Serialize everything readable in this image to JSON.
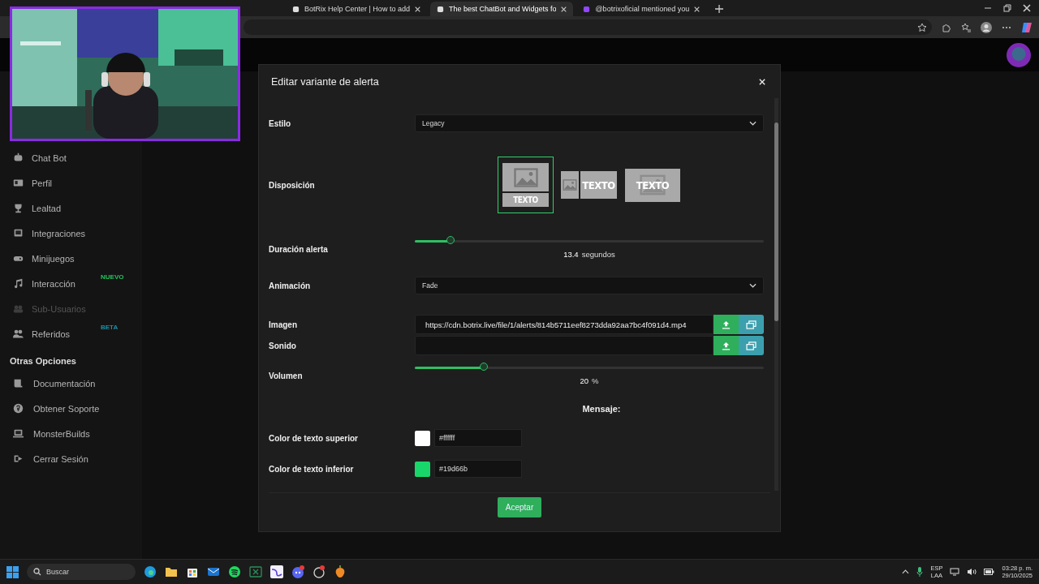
{
  "browser": {
    "tabs": [
      {
        "title": "BotRix Help Center | How to add",
        "selected": false
      },
      {
        "title": "The best ChatBot and Widgets fo",
        "selected": true
      },
      {
        "title": "@botrixoficial mentioned you",
        "selected": false
      }
    ]
  },
  "sidebar": {
    "items": [
      {
        "label": "Chat Bot",
        "disabled": false
      },
      {
        "label": "Perfil",
        "disabled": false
      },
      {
        "label": "Lealtad",
        "disabled": false
      },
      {
        "label": "Integraciones",
        "disabled": false
      },
      {
        "label": "Minijuegos",
        "disabled": false
      },
      {
        "label": "Interacción",
        "disabled": false,
        "badge": {
          "text": "NUEVO",
          "color": "#22c55e"
        }
      },
      {
        "label": "Sub-Usuarios",
        "disabled": true
      },
      {
        "label": "Referidos",
        "disabled": false,
        "badge": {
          "text": "BETA",
          "color": "#1c8fa6"
        }
      }
    ],
    "section_title": "Otras Opciones",
    "other_items": [
      {
        "label": "Documentación",
        "disabled": false
      },
      {
        "label": "Obtener Soporte",
        "disabled": false
      },
      {
        "label": "MonsterBuilds",
        "disabled": false
      },
      {
        "label": "Cerrar Sesión",
        "disabled": false
      }
    ]
  },
  "modal": {
    "title": "Editar variante de alerta",
    "rows": [
      {
        "kind": "select",
        "label": "Estilo",
        "value": "Legacy"
      },
      {
        "kind": "layout",
        "label": "Disposición",
        "options": [
          {
            "kind": "stacked",
            "label": "TEXTO",
            "selected": true
          },
          {
            "kind": "side",
            "label": "TEXTO",
            "selected": false
          },
          {
            "kind": "overlay",
            "label": "TEXTO",
            "selected": false
          }
        ]
      },
      {
        "kind": "slider",
        "label": "Duración alerta",
        "level": 0.105,
        "reading": "13.4",
        "unit": "segundos"
      },
      {
        "kind": "select",
        "label": "Animación",
        "value": "Fade"
      },
      {
        "kind": "file",
        "label": "Imagen",
        "value": "https://cdn.botrix.live/file/1/alerts/814b5711eef8273dda92aa7bc4f091d4.mp4"
      },
      {
        "kind": "file",
        "label": "Sonido"
      },
      {
        "kind": "slider",
        "label": "Volumen",
        "level": 0.2,
        "reading": "20",
        "unit": "%"
      },
      {
        "kind": "heading",
        "label": "Mensaje:"
      },
      {
        "kind": "color",
        "label": "Color de texto superior",
        "color": "#ffffff",
        "value": "#ffffff"
      },
      {
        "kind": "color",
        "label": "Color de texto inferior",
        "color": "#19d66b",
        "value": "#19d66b"
      }
    ],
    "button": "Aceptar"
  },
  "taskbar": {
    "search_placeholder": "Buscar",
    "language": [
      "ESP",
      "LAA"
    ],
    "time": "03:28 p. m.",
    "date": "29/10/2025"
  }
}
